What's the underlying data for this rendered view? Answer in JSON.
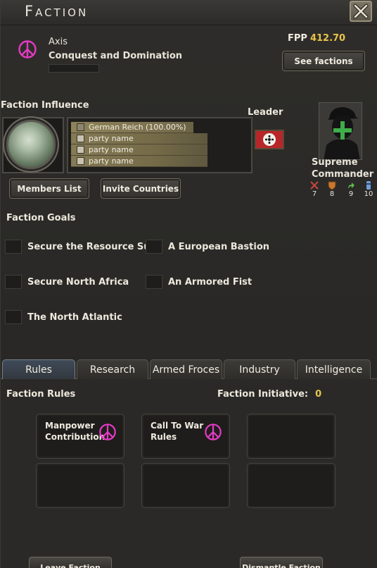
{
  "window": {
    "title": "Faction",
    "close_icon": "close-x-icon"
  },
  "faction": {
    "name": "Axis",
    "ideology": "Conquest and Domination",
    "icon": "peace-symbol-icon",
    "icon_color": "#e23ac3"
  },
  "fpp": {
    "label": "FPP",
    "value": "412.70"
  },
  "buttons": {
    "see_factions": "See factions",
    "members_list": "Members List",
    "invite_countries": "Invite Countries",
    "leave_faction": "Leave Faction",
    "dismantle_faction": "Dismantle Faction"
  },
  "influence": {
    "label": "Faction Influence",
    "parties": [
      "German Reich (100.00%)",
      "party name",
      "party name",
      "party name"
    ]
  },
  "leader": {
    "label": "Leader",
    "flag": "german-reich-flag"
  },
  "commander": {
    "label_line1": "Supreme",
    "label_line2": "Commander",
    "skills": [
      {
        "icon": "attack-icon",
        "value": "7"
      },
      {
        "icon": "defense-icon",
        "value": "8"
      },
      {
        "icon": "planning-icon",
        "value": "9"
      },
      {
        "icon": "logistics-icon",
        "value": "10"
      }
    ]
  },
  "goals": {
    "label": "Faction Goals",
    "items": [
      "Secure the Resource Su...",
      "A European Bastion",
      "Secure North Africa",
      "An Armored Fist",
      "The North Atlantic"
    ]
  },
  "tabs": [
    {
      "label": "Rules",
      "active": true
    },
    {
      "label": "Research",
      "active": false
    },
    {
      "label": "Armed Froces",
      "active": false
    },
    {
      "label": "Industry",
      "active": false
    },
    {
      "label": "Intelligence",
      "active": false
    }
  ],
  "rules": {
    "label": "Faction Rules",
    "initiative_label": "Faction Initiative:",
    "initiative_value": "0",
    "slots": [
      {
        "line1": "Manpower",
        "line2": "Contribution",
        "icon": "peace-symbol-icon"
      },
      {
        "line1": "Call To War",
        "line2": "Rules",
        "icon": "peace-symbol-icon"
      }
    ]
  }
}
